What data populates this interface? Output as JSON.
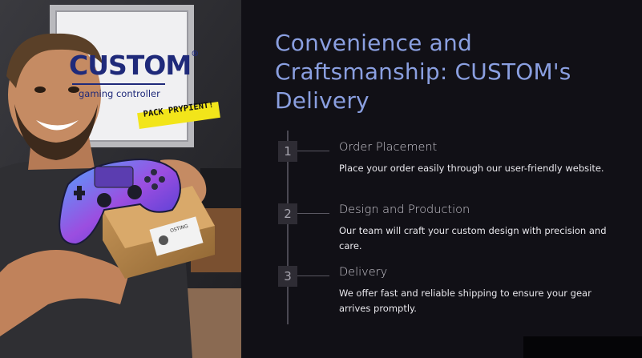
{
  "title": "Convenience and Craftsmanship: CUSTOM's Delivery",
  "photo": {
    "sign_brand": "CUSTOM",
    "sign_trademark": "®",
    "sign_tagline": "gaming controller",
    "sticker_text": "PACK PRYPIENT!",
    "box_label": "OSTING",
    "icon": "photo-person-with-controller"
  },
  "steps": [
    {
      "number": "1",
      "title": "Order Placement",
      "description": "Place your order easily through our user-friendly website."
    },
    {
      "number": "2",
      "title": "Design and Production",
      "description": "Our team will craft your custom design with precision and care."
    },
    {
      "number": "3",
      "title": "Delivery",
      "description": "We offer fast and reliable shipping to ensure your gear arrives promptly."
    }
  ],
  "colors": {
    "background": "#111016",
    "title": "#8a9fe0",
    "step_title": "#c7c5cd",
    "step_desc": "#e8e7ec",
    "timeline": "#4a4852"
  }
}
